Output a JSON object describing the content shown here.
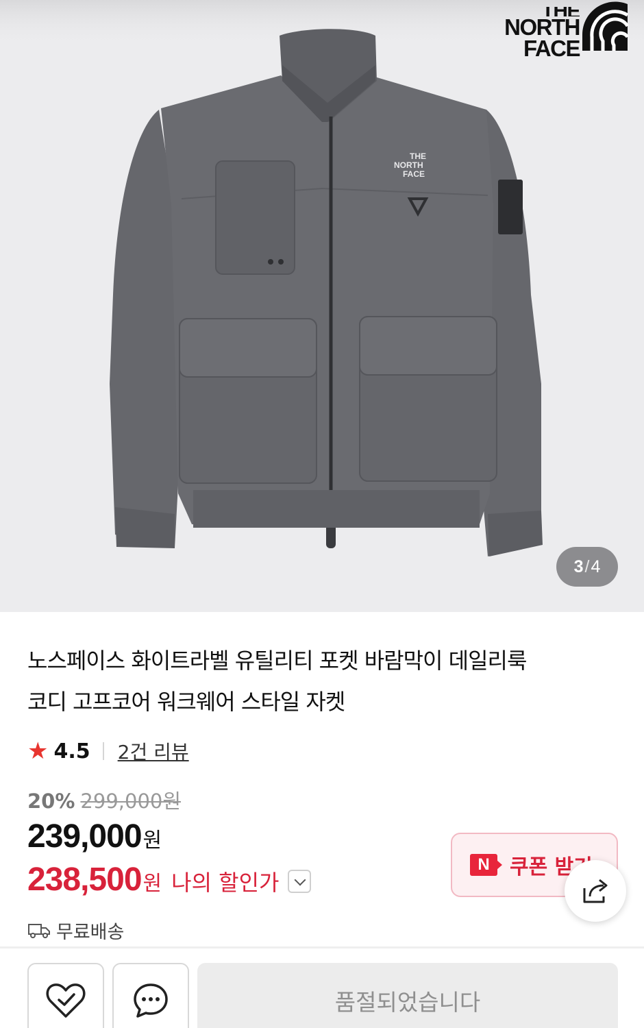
{
  "brand": {
    "logo_text_line1": "THE",
    "logo_text_line2": "NORTH",
    "logo_text_line3": "FACE"
  },
  "gallery": {
    "current": "3",
    "separator": "/",
    "total": "4"
  },
  "product": {
    "title_line1": "노스페이스 화이트라벨 유틸리티 포켓 바람막이 데일리룩",
    "title_line2": "코디 고프코어 워크웨어 스타일 자켓",
    "rating": "4.5",
    "reviews": "2건 리뷰",
    "discount_pct": "20%",
    "original_price": "299,000원",
    "price": "239,000",
    "price_unit": "원",
    "my_price": "238,500",
    "my_price_unit": "원",
    "my_price_label": "나의 할인가",
    "shipping": "무료배송"
  },
  "coupon": {
    "badge": "N",
    "label": "쿠폰 받기"
  },
  "actions": {
    "soldout_label": "품절되었습니다"
  },
  "colors": {
    "accent_red": "#d8223a",
    "jacket_gray": "#6a6b70"
  }
}
